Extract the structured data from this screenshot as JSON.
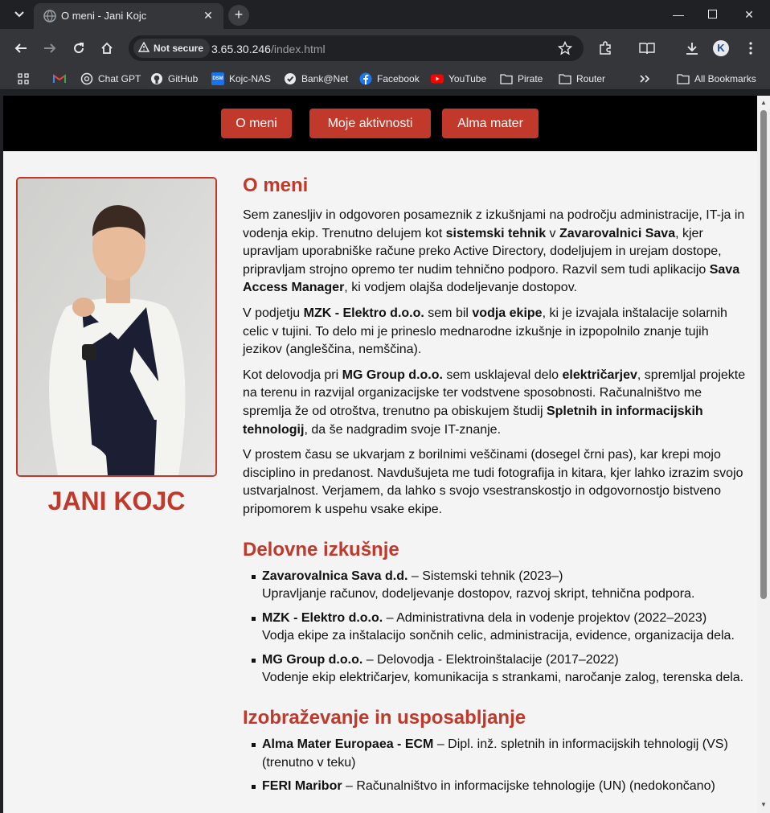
{
  "browser": {
    "tab_title": "O meni - Jani Kojc",
    "security_label": "Not secure",
    "url_host": "3.65.30.246",
    "url_path": "/index.html",
    "profile_initial": "K",
    "bookmarks": [
      {
        "label": "",
        "icon": "gmail-icon"
      },
      {
        "label": "Chat GPT",
        "icon": "openai-icon"
      },
      {
        "label": "GitHub",
        "icon": "github-icon"
      },
      {
        "label": "Kojc-NAS",
        "icon": "dsm-icon"
      },
      {
        "label": "Bank@Net",
        "icon": "bank-icon"
      },
      {
        "label": "Facebook",
        "icon": "facebook-icon"
      },
      {
        "label": "YouTube",
        "icon": "youtube-icon"
      },
      {
        "label": "Pirate",
        "icon": "folder-icon"
      },
      {
        "label": "Router",
        "icon": "folder-icon"
      }
    ],
    "all_bookmarks_label": "All Bookmarks",
    "dsm_glyph": "DSM"
  },
  "nav": {
    "items": [
      "O meni",
      "Moje aktivnosti",
      "Alma mater"
    ]
  },
  "profile": {
    "name": "JANI KOJC"
  },
  "about": {
    "heading": "O meni",
    "p1": [
      "Sem zanesljiv in odgovoren posameznik z izkušnjami na področju administracije, IT-ja in vodenja ekip. Trenutno delujem kot ",
      "sistemski tehnik",
      " v ",
      "Zavarovalnici Sava",
      ", kjer upravljam uporabniške račune preko Active Directory, dodeljujem in urejam dostope, pripravljam strojno opremo ter nudim tehnično podporo. Razvil sem tudi aplikacijo ",
      "Sava Access Manager",
      ", ki vodjem olajša dodeljevanje dostopov."
    ],
    "p2": [
      "V podjetju ",
      "MZK - Elektro d.o.o.",
      " sem bil ",
      "vodja ekipe",
      ", ki je izvajala inštalacije solarnih celic v tujini. To delo mi je prineslo mednarodne izkušnje in izpopolnilo znanje tujih jezikov (angleščina, nemščina)."
    ],
    "p3": [
      "Kot delovodja pri ",
      "MG Group d.o.o.",
      " sem usklajeval delo ",
      "električarjev",
      ", spremljal projekte na terenu in razvijal organizacijske ter vodstvene sposobnosti. Računalništvo me spremlja že od otroštva, trenutno pa obiskujem študij ",
      "Spletnih in informacijskih tehnologij",
      ", da še nadgradim svoje IT-znanje."
    ],
    "p4": "V prostem času se ukvarjam z borilnimi veščinami (dosegel črni pas), kar krepi mojo disciplino in predanost. Navdušujeta me tudi fotografija in kitara, kjer lahko izrazim svojo ustvarjalnost. Verjamem, da lahko s svojo vsestranskostjo in odgovornostjo bistveno pripomorem k uspehu vsake ekipe."
  },
  "experience": {
    "heading": "Delovne izkušnje",
    "items": [
      {
        "company": "Zavarovalnica Sava d.d.",
        "role": " – Sistemski tehnik (2023–)",
        "desc": "Upravljanje računov, dodeljevanje dostopov, razvoj skript, tehnična podpora."
      },
      {
        "company": "MZK - Elektro d.o.o.",
        "role": " – Administrativna dela in vodenje projektov (2022–2023)",
        "desc": "Vodja ekipe za inštalacijo sončnih celic, administracija, evidence, organizacija dela."
      },
      {
        "company": "MG Group d.o.o.",
        "role": " – Delovodja - Elektroinštalacije (2017–2022)",
        "desc": "Vodenje ekip električarjev, komunikacija s strankami, naročanje zalog, terenska dela."
      }
    ]
  },
  "education": {
    "heading": "Izobraževanje in usposabljanje",
    "items": [
      {
        "school": "Alma Mater Europaea - ECM",
        "detail": " – Dipl. inž. spletnih in informacijskih tehnologij (VS) (trenutno v teku)"
      },
      {
        "school": "FERI Maribor",
        "detail": " – Računalništvo in informacijske tehnologije (UN) (nedokončano)"
      }
    ]
  },
  "colors": {
    "accent": "#c0392b",
    "nav_bg": "#000000",
    "page_bg": "#f5f4f4"
  }
}
